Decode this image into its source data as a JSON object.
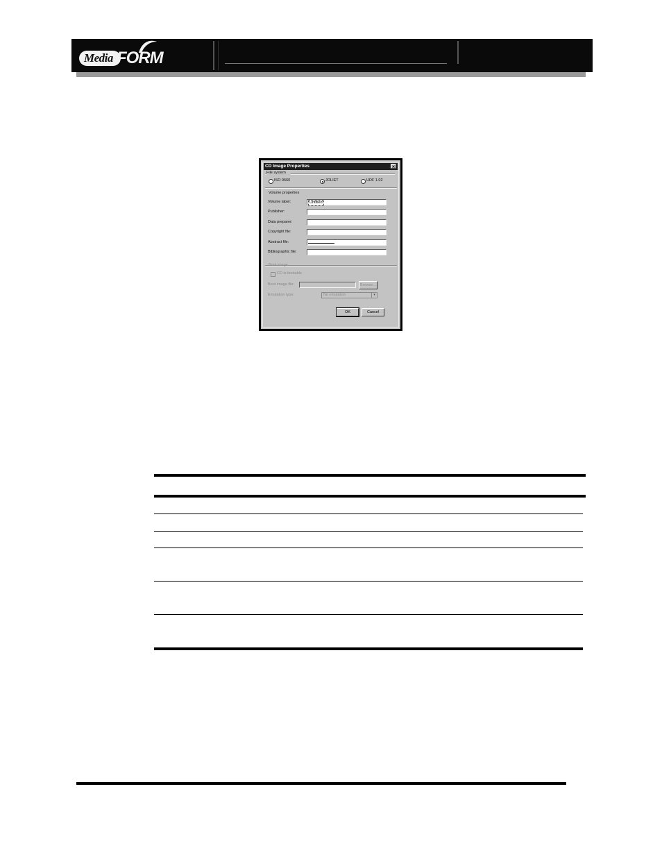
{
  "header": {
    "logo_text_left": "Media",
    "logo_text_right": "FORM"
  },
  "dialog": {
    "title": "CD Image Properties",
    "close_glyph": "×",
    "file_system": {
      "group_label": "File system",
      "options": [
        {
          "label": "ISO 9660",
          "selected": false
        },
        {
          "label": "JOLIET",
          "selected": true
        },
        {
          "label": "UDF 1.02",
          "selected": false
        }
      ]
    },
    "volume_properties": {
      "group_label": "Volume properties",
      "fields": [
        {
          "label": "Volume label:",
          "value": "Untitled"
        },
        {
          "label": "Publisher:",
          "value": ""
        },
        {
          "label": "Data preparer:",
          "value": ""
        },
        {
          "label": "Copyright file:",
          "value": ""
        },
        {
          "label": "Abstract file:",
          "value": ""
        },
        {
          "label": "Bibliographic file:",
          "value": ""
        }
      ]
    },
    "bootable": {
      "group_label": "Boot image",
      "checkbox_label": "CD is bootable",
      "image_label": "Boot image file:",
      "browse_label": "Browse...",
      "emulation_label": "Emulation type:",
      "emulation_value": "No emulation"
    },
    "ok_label": "OK",
    "cancel_label": "Cancel"
  },
  "table": {
    "rows": 6
  },
  "colors": {
    "header_bar": "#0a0a0a",
    "header_shadow": "#9a9a9a",
    "dialog_face": "#c3c3c3",
    "title_bar": "#1e1e1e"
  }
}
